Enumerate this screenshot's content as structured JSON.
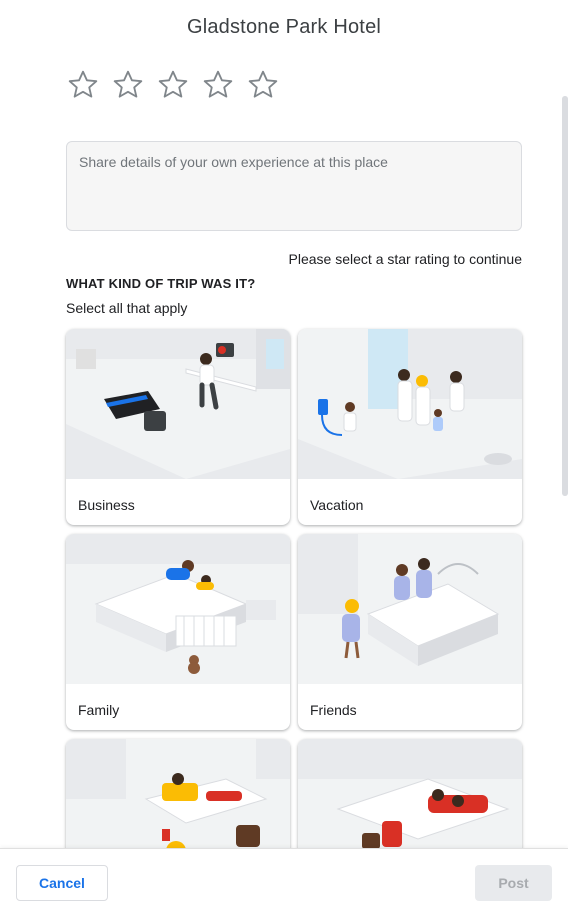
{
  "header": {
    "title": "Gladstone Park Hotel"
  },
  "rating": {
    "max_stars": 5,
    "selected": 0,
    "star_color": "#80868b"
  },
  "review": {
    "placeholder": "Share details of your own experience at this place",
    "value": ""
  },
  "hint": "Please select a star rating to continue",
  "trip": {
    "title": "WHAT KIND OF TRIP WAS IT?",
    "subtitle": "Select all that apply",
    "options": [
      {
        "label": "Business",
        "icon": "business-illustration"
      },
      {
        "label": "Vacation",
        "icon": "vacation-illustration"
      },
      {
        "label": "Family",
        "icon": "family-illustration"
      },
      {
        "label": "Friends",
        "icon": "friends-illustration"
      },
      {
        "label": "",
        "icon": "solo-illustration"
      },
      {
        "label": "",
        "icon": "couple-illustration"
      }
    ]
  },
  "footer": {
    "cancel_label": "Cancel",
    "post_label": "Post"
  },
  "colors": {
    "accent": "#1a73e8",
    "disabled_bg": "#e8eaed",
    "disabled_text": "#a8abaf"
  }
}
